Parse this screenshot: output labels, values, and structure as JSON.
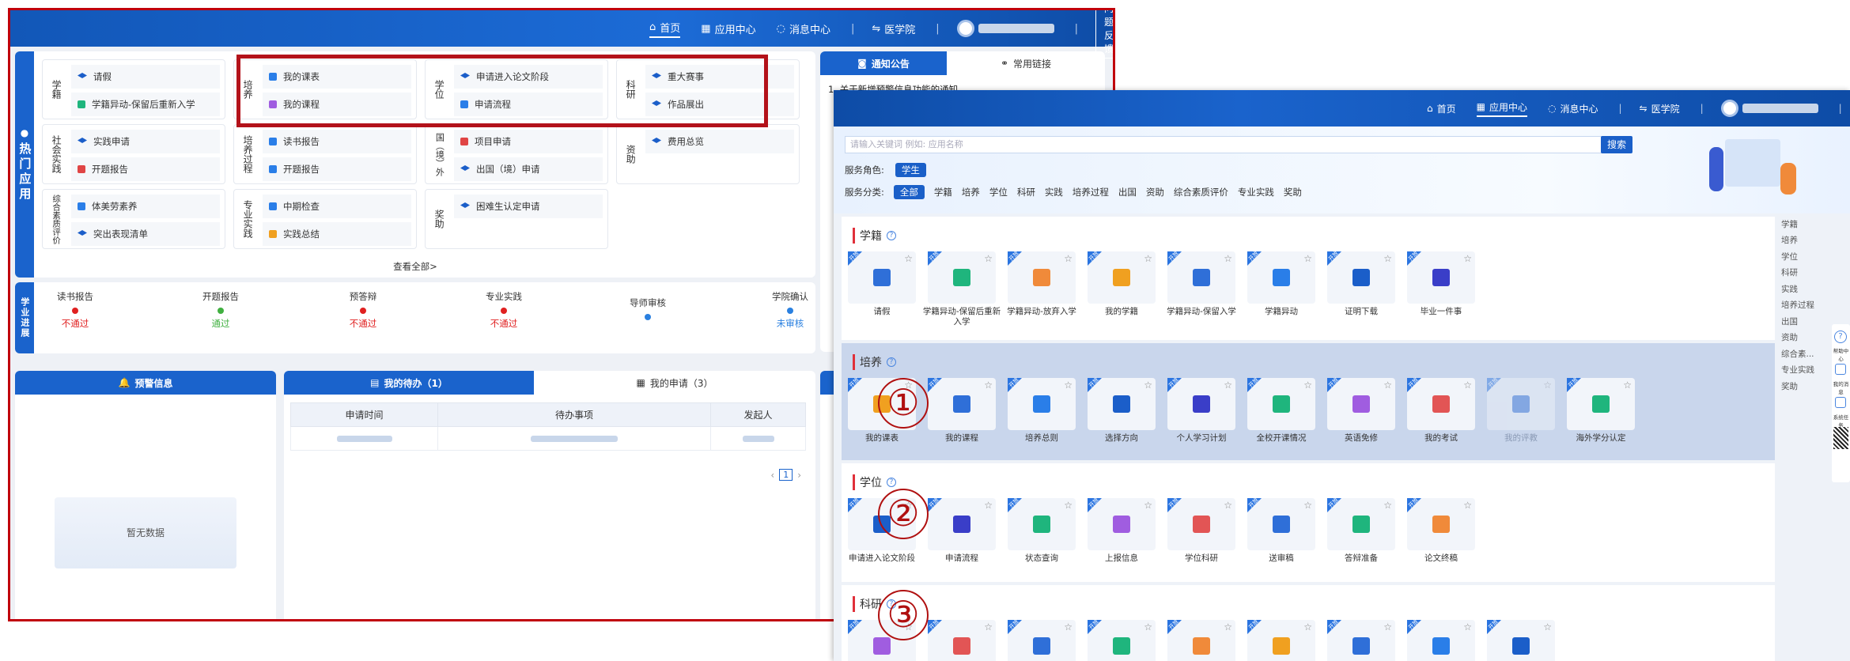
{
  "header": {
    "nav": [
      {
        "icon": "home-icon",
        "label": "首页",
        "active": true
      },
      {
        "icon": "grid-icon",
        "label": "应用中心",
        "active": false
      },
      {
        "icon": "message-icon",
        "label": "消息中心",
        "active": false
      },
      {
        "icon": "college-icon",
        "label": "医学院",
        "active": false
      }
    ],
    "feedback": "问题反馈"
  },
  "hot_apps": {
    "side_label": "热门应用",
    "categories": [
      {
        "title": "学籍",
        "items": [
          "请假",
          "学籍异动-保留后重新入学"
        ]
      },
      {
        "title": "培养",
        "items": [
          "我的课表",
          "我的课程"
        ]
      },
      {
        "title": "学位",
        "items": [
          "申请进入论文阶段",
          "申请流程"
        ]
      },
      {
        "title": "科研",
        "items": [
          "重大赛事",
          "作品展出"
        ]
      },
      {
        "title": "社会实践",
        "items": [
          "实践申请",
          "开题报告"
        ]
      },
      {
        "title": "培养过程",
        "items": [
          "读书报告",
          "开题报告"
        ]
      },
      {
        "title": "国（境）外",
        "items": [
          "项目申请",
          "出国（境）申请"
        ]
      },
      {
        "title": "资助",
        "items": [
          "费用总览"
        ]
      },
      {
        "title": "综合素质评价",
        "items": [
          "体美劳素养",
          "突出表现清单"
        ]
      },
      {
        "title": "专业实践",
        "items": [
          "中期检查",
          "实践总结"
        ]
      },
      {
        "title": "奖助",
        "items": [
          "困难生认定申请"
        ]
      }
    ],
    "view_all": "查看全部>"
  },
  "progress": {
    "side_label": "学业进展",
    "steps": [
      {
        "name": "读书报告",
        "status": "不通过",
        "color": "#e02020"
      },
      {
        "name": "开题报告",
        "status": "通过",
        "color": "#40b040"
      },
      {
        "name": "预答辩",
        "status": "不通过",
        "color": "#e02020"
      },
      {
        "name": "专业实践",
        "status": "不通过",
        "color": "#e02020"
      },
      {
        "name": "导师审核",
        "status": "",
        "color": "#2a80e0"
      },
      {
        "name": "学院确认",
        "status": "未审核",
        "color": "#2a80e0"
      }
    ]
  },
  "notice": {
    "tab_active": "通知公告",
    "tab_other": "常用链接",
    "first_item": "1. 关于新增预警信息功能的通知"
  },
  "warning": {
    "title": "预警信息",
    "empty": "暂无数据"
  },
  "todo": {
    "tab_active": "我的待办（1）",
    "tab_other": "我的申请（3）",
    "columns": [
      "申请时间",
      "待办事项",
      "发起人"
    ],
    "page": "1"
  },
  "app_center": {
    "search_placeholder": "请输入关键词 例如: 应用名称",
    "search_button": "搜索",
    "role_label": "服务角色:",
    "role_value": "学生",
    "category_label": "服务分类:",
    "category_active": "全部",
    "categories": [
      "学籍",
      "培养",
      "学位",
      "科研",
      "实践",
      "培养过程",
      "出国",
      "资助",
      "综合素质评价",
      "专业实践",
      "奖助"
    ],
    "tag_text": "开放",
    "sections": [
      {
        "title": "学籍",
        "tiles": [
          "请假",
          "学籍异动-保留后重新入学",
          "学籍异动-放弃入学",
          "我的学籍",
          "学籍异动-保留入学",
          "学籍异动",
          "证明下载",
          "毕业一件事"
        ]
      },
      {
        "title": "培养",
        "tiles": [
          "我的课表",
          "我的课程",
          "培养总则",
          "选择方向",
          "个人学习计划",
          "全校开课情况",
          "英语免修",
          "我的考试",
          "我的评教",
          "海外学分认定"
        ]
      },
      {
        "title": "学位",
        "tiles": [
          "申请进入论文阶段",
          "申请流程",
          "状态查询",
          "上报信息",
          "学位科研",
          "送审稿",
          "答辩准备",
          "论文终稿"
        ]
      },
      {
        "title": "科研",
        "tiles": [
          "",
          "",
          "",
          "",
          "",
          "",
          "",
          "",
          ""
        ]
      }
    ],
    "right_nav": [
      "学籍",
      "培养",
      "学位",
      "科研",
      "实践",
      "培养过程",
      "出国",
      "资助",
      "综合素...",
      "专业实践",
      "奖助"
    ],
    "side_tools": [
      "帮助中心",
      "我的消息",
      "系统任务"
    ],
    "annotations": [
      "①",
      "②",
      "③"
    ]
  }
}
